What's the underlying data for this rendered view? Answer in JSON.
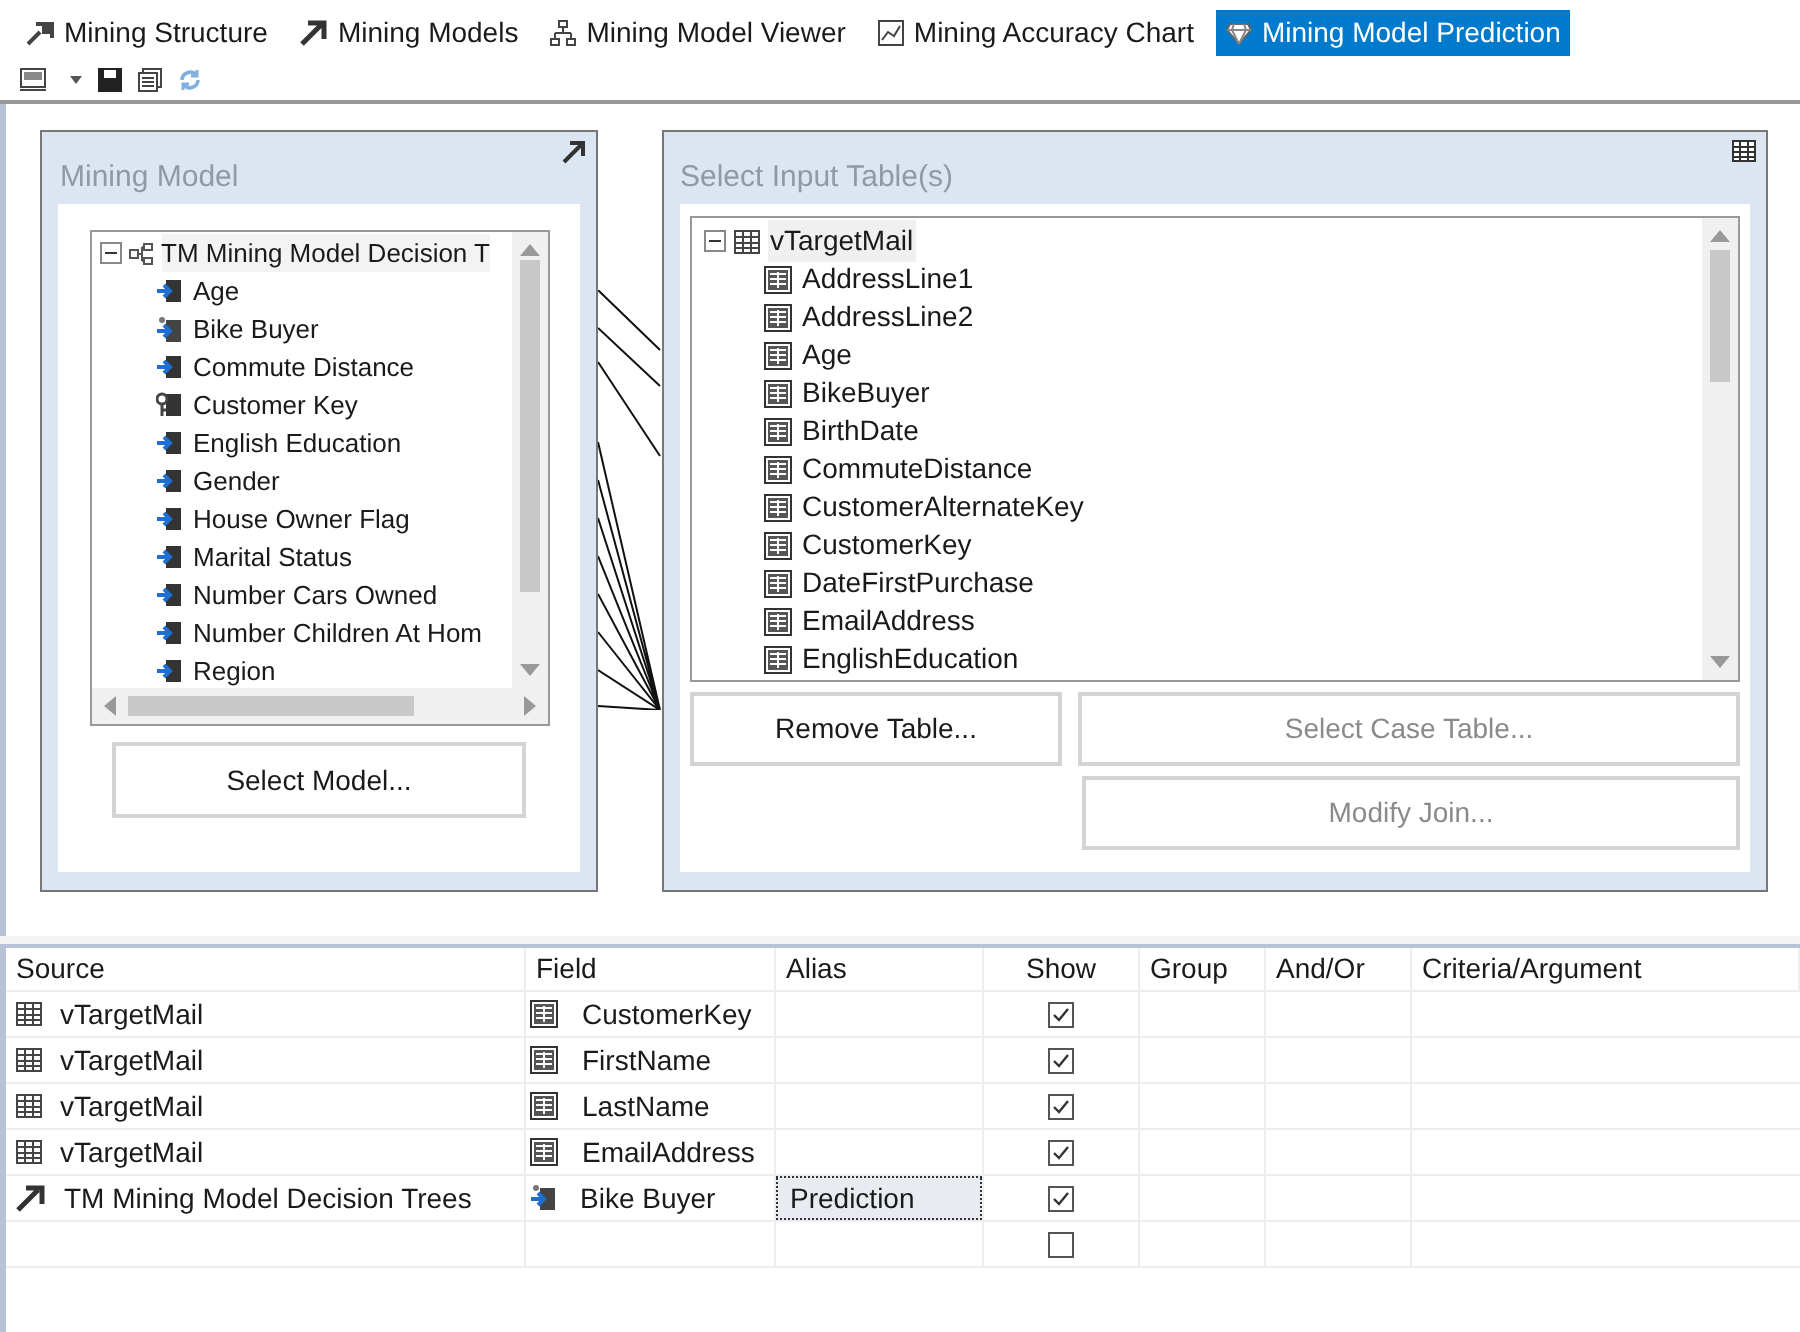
{
  "tabs": [
    {
      "label": "Mining Structure",
      "kind": "structure",
      "selected": false
    },
    {
      "label": "Mining Models",
      "kind": "models",
      "selected": false
    },
    {
      "label": "Mining Model Viewer",
      "kind": "viewer",
      "selected": false
    },
    {
      "label": "Mining Accuracy Chart",
      "kind": "chart",
      "selected": false
    },
    {
      "label": "Mining Model Prediction",
      "kind": "prediction",
      "selected": true
    }
  ],
  "mining_model": {
    "title": "Mining Model",
    "tree": {
      "label": "TM Mining Model Decision T",
      "expanded": true,
      "children": [
        {
          "label": "Age",
          "kind": "input"
        },
        {
          "label": "Bike Buyer",
          "kind": "predict"
        },
        {
          "label": "Commute Distance",
          "kind": "input"
        },
        {
          "label": "Customer Key",
          "kind": "key"
        },
        {
          "label": "English Education",
          "kind": "input"
        },
        {
          "label": "Gender",
          "kind": "input"
        },
        {
          "label": "House Owner Flag",
          "kind": "input"
        },
        {
          "label": "Marital Status",
          "kind": "input"
        },
        {
          "label": "Number Cars Owned",
          "kind": "input"
        },
        {
          "label": "Number Children At Hom",
          "kind": "input"
        },
        {
          "label": "Region",
          "kind": "input"
        }
      ]
    },
    "button": "Select Model..."
  },
  "input_tables": {
    "title": "Select Input Table(s)",
    "tree": {
      "label": "vTargetMail",
      "expanded": true,
      "children": [
        {
          "label": "AddressLine1"
        },
        {
          "label": "AddressLine2"
        },
        {
          "label": "Age"
        },
        {
          "label": "BikeBuyer"
        },
        {
          "label": "BirthDate"
        },
        {
          "label": "CommuteDistance"
        },
        {
          "label": "CustomerAlternateKey"
        },
        {
          "label": "CustomerKey"
        },
        {
          "label": "DateFirstPurchase"
        },
        {
          "label": "EmailAddress"
        },
        {
          "label": "EnglishEducation"
        }
      ]
    },
    "buttons": [
      {
        "label": "Remove Table...",
        "disabled": false
      },
      {
        "label": "Select Case Table...",
        "disabled": true
      },
      {
        "label": "Modify Join...",
        "disabled": true
      }
    ]
  },
  "grid": {
    "columns": [
      "Source",
      "Field",
      "Alias",
      "Show",
      "Group",
      "And/Or",
      "Criteria/Argument"
    ],
    "rows": [
      {
        "source": {
          "label": "vTargetMail",
          "kind": "table"
        },
        "field": {
          "label": "CustomerKey",
          "kind": "column"
        },
        "show": true
      },
      {
        "source": {
          "label": "vTargetMail",
          "kind": "table"
        },
        "field": {
          "label": "FirstName",
          "kind": "column"
        },
        "show": true
      },
      {
        "source": {
          "label": "vTargetMail",
          "kind": "table"
        },
        "field": {
          "label": "LastName",
          "kind": "column"
        },
        "show": true
      },
      {
        "source": {
          "label": "vTargetMail",
          "kind": "table"
        },
        "field": {
          "label": "EmailAddress",
          "kind": "column"
        },
        "show": true
      },
      {
        "source": {
          "label": "TM Mining Model Decision Trees",
          "kind": "model"
        },
        "field": {
          "label": "Bike Buyer",
          "kind": "predict"
        },
        "alias": "Prediction",
        "selected": true,
        "show": true
      },
      {
        "show": false
      }
    ]
  }
}
